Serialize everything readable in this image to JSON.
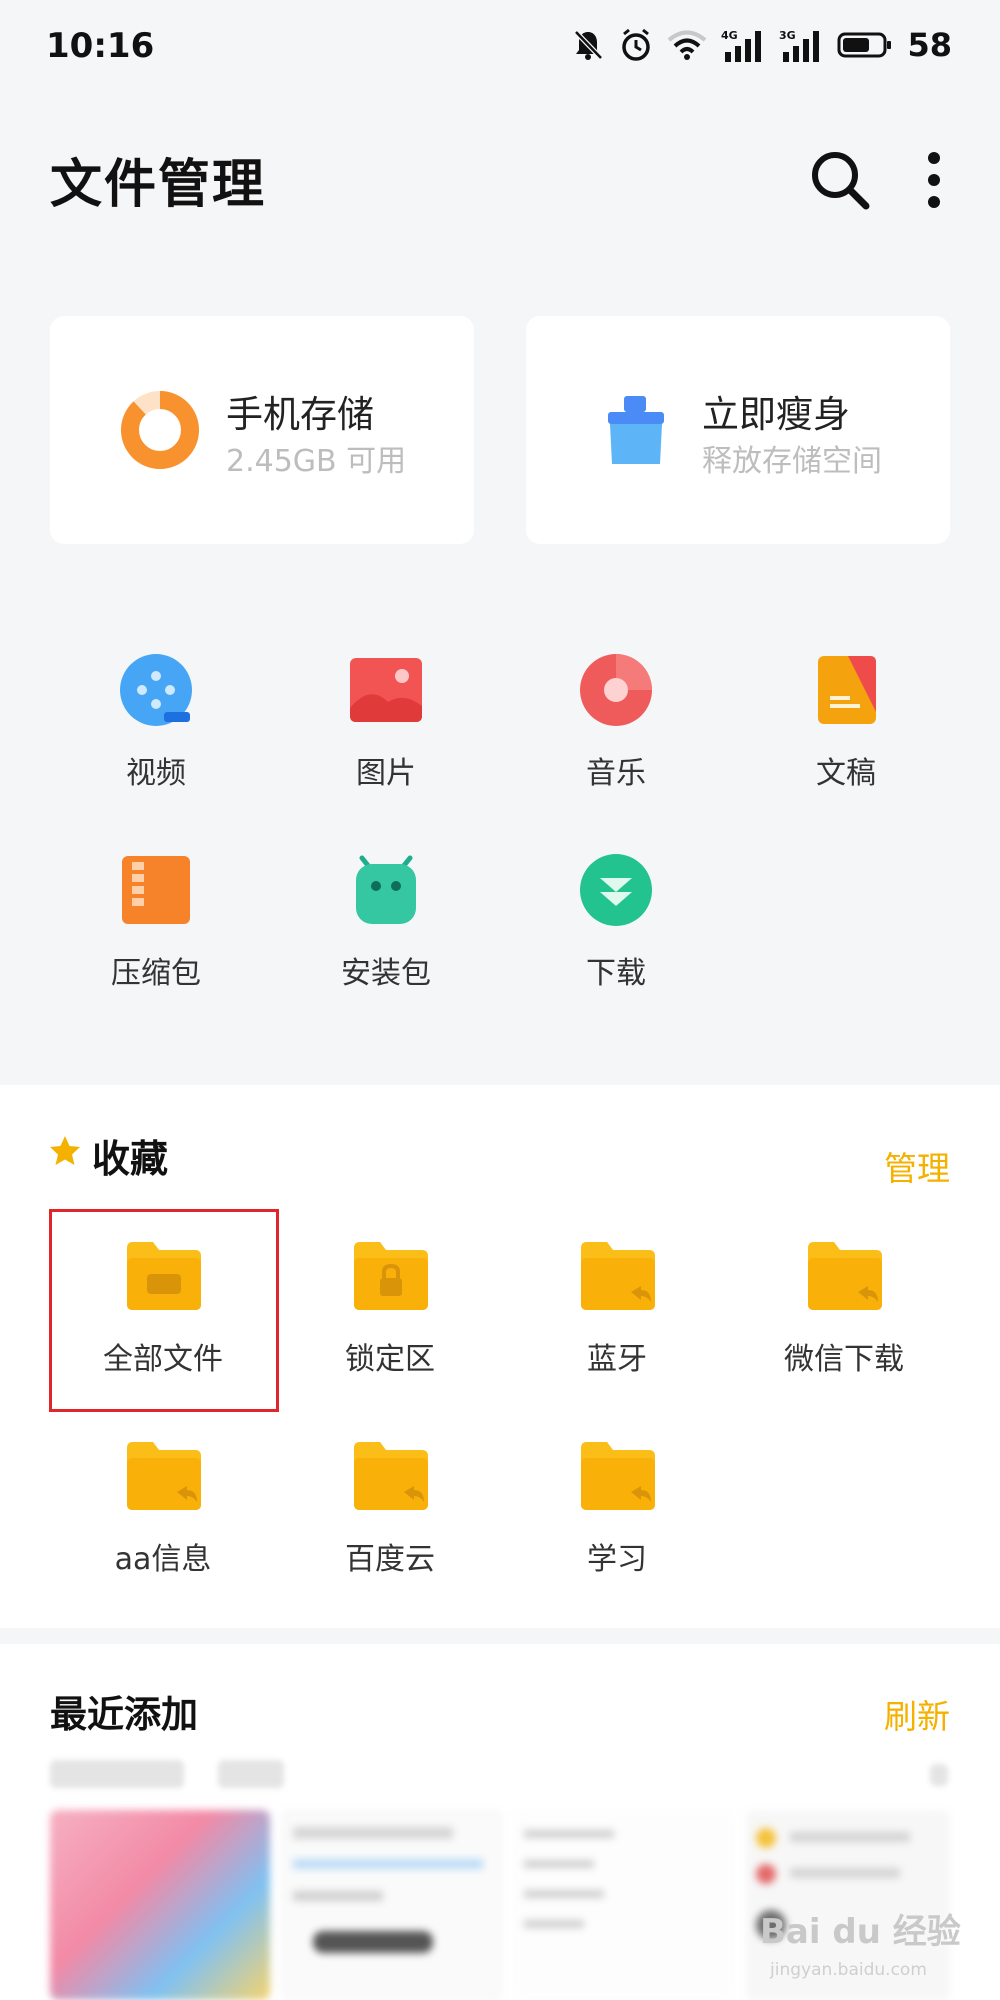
{
  "status_bar": {
    "time": "10:16",
    "battery": "58",
    "net_a": "4G",
    "net_b": "3G"
  },
  "header": {
    "title": "文件管理"
  },
  "storage_card": {
    "title": "手机存储",
    "subtitle": "2.45GB 可用",
    "used_fraction": 0.88
  },
  "cleanup_card": {
    "title": "立即瘦身",
    "subtitle": "释放存储空间"
  },
  "categories": [
    {
      "label": "视频",
      "icon": "video-icon"
    },
    {
      "label": "图片",
      "icon": "image-icon"
    },
    {
      "label": "音乐",
      "icon": "music-icon"
    },
    {
      "label": "文稿",
      "icon": "document-icon"
    },
    {
      "label": "压缩包",
      "icon": "archive-icon"
    },
    {
      "label": "安装包",
      "icon": "apk-icon"
    },
    {
      "label": "下载",
      "icon": "download-icon"
    }
  ],
  "favorites": {
    "title": "收藏",
    "manage": "管理",
    "folders": [
      {
        "label": "全部文件"
      },
      {
        "label": "锁定区"
      },
      {
        "label": "蓝牙"
      },
      {
        "label": "微信下载"
      },
      {
        "label": "aa信息"
      },
      {
        "label": "百度云"
      },
      {
        "label": "学习"
      }
    ]
  },
  "recent": {
    "title": "最近添加",
    "refresh": "刷新"
  },
  "watermark": {
    "brand": "Bai du 经验",
    "url": "jingyan.baidu.com"
  },
  "colors": {
    "accent": "#f5b100",
    "highlight": "#e0262b",
    "folder": "#fbbd18"
  }
}
